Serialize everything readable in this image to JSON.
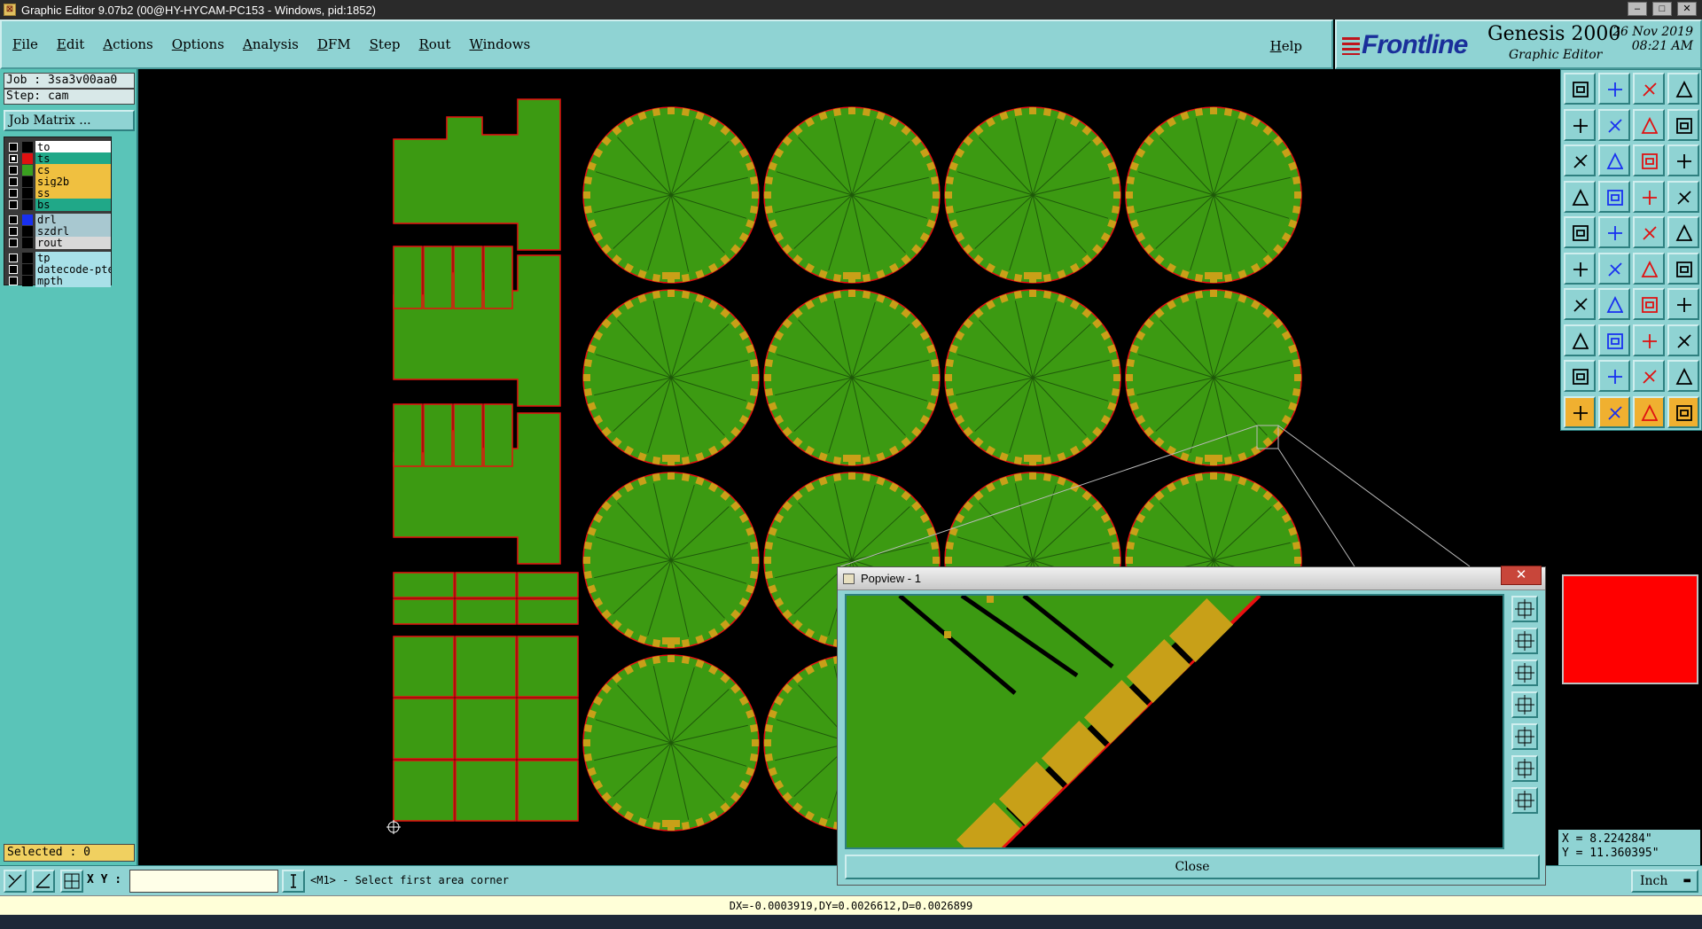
{
  "window": {
    "title": "Graphic Editor 9.07b2 (00@HY-HYCAM-PC153 - Windows, pid:1852)"
  },
  "menu": {
    "items": [
      "File",
      "Edit",
      "Actions",
      "Options",
      "Analysis",
      "DFM",
      "Step",
      "Rout",
      "Windows"
    ],
    "help": "Help"
  },
  "brand": {
    "logo": "Frontline",
    "product": "Genesis 2000",
    "subtitle": "Graphic Editor",
    "date": "26 Nov 2019",
    "time": "08:21 AM"
  },
  "job": {
    "job_label": "Job : 3sa3v00aa0",
    "step_label": "Step: cam",
    "matrix_button": "Job Matrix ..."
  },
  "layers": [
    {
      "name": "to",
      "color": "#ffffff",
      "checked": false,
      "swatch": "#000000"
    },
    {
      "name": "ts",
      "color": "#20a888",
      "checked": true,
      "swatch": "#e01010"
    },
    {
      "name": "cs",
      "color": "#f0c040",
      "checked": false,
      "swatch": "#3aa020"
    },
    {
      "name": "sig2b",
      "color": "#f0c040",
      "checked": false,
      "swatch": "#000000"
    },
    {
      "name": "ss",
      "color": "#f0c040",
      "checked": false,
      "swatch": "#000000"
    },
    {
      "name": "bs",
      "color": "#20a888",
      "checked": false,
      "swatch": "#000000"
    },
    {
      "name": "drl",
      "color": "#a8c8d0",
      "checked": false,
      "swatch": "#1830f0"
    },
    {
      "name": "szdrl",
      "color": "#a8c8d0",
      "checked": false,
      "swatch": "#000000"
    },
    {
      "name": "rout",
      "color": "#d8d8d8",
      "checked": false,
      "swatch": "#000000"
    },
    {
      "name": "tp",
      "color": "#a8e0e8",
      "checked": false,
      "swatch": "#000000"
    },
    {
      "name": "datecode-pte",
      "color": "#a8e0e8",
      "checked": false,
      "swatch": "#000000"
    },
    {
      "name": "mpth",
      "color": "#a8e0e8",
      "checked": false,
      "swatch": "#000000"
    }
  ],
  "selected_label": "Selected : 0",
  "coords": {
    "x": "X =  8.224284\"",
    "y": "Y = 11.360395\""
  },
  "command": {
    "xy_label": "X Y :",
    "xy_value": "",
    "prompt": "<M1> - Select first area corner",
    "units": "Inch"
  },
  "status": "DX=-0.0003919,DY=0.0026612,D=0.0026899",
  "popview": {
    "title": "Popview - 1",
    "close_label": "Close",
    "close_x": "✕"
  },
  "colors": {
    "board_green": "#3c9a12",
    "pad_gold": "#c8a018",
    "outline_red": "#e81010",
    "panel_cyan": "#8fd3d3"
  }
}
